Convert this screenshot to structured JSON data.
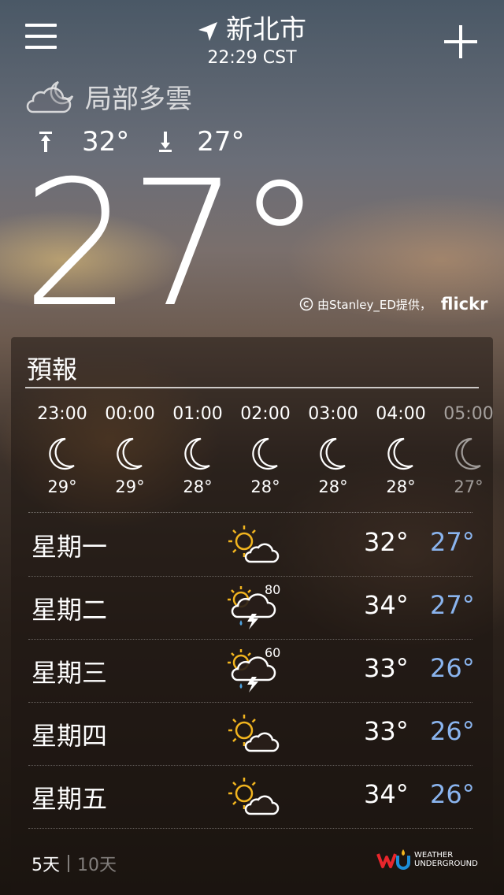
{
  "header": {
    "city": "新北市",
    "time": "22:29 CST",
    "menu_icon": "hamburger-menu-icon",
    "add_icon": "plus-icon",
    "location_icon": "location-arrow-icon"
  },
  "current": {
    "condition": "局部多雲",
    "condition_icon": "partly-cloudy-night-icon",
    "high": "32°",
    "low": "27°",
    "temperature": "27°"
  },
  "photo_credit": {
    "text": "由Stanley_ED提供，",
    "brand": "flickr"
  },
  "forecast": {
    "title": "預報",
    "hourly": [
      {
        "time": "23:00",
        "temp": "29°",
        "icon": "moon-icon"
      },
      {
        "time": "00:00",
        "temp": "29°",
        "icon": "moon-icon"
      },
      {
        "time": "01:00",
        "temp": "28°",
        "icon": "moon-icon"
      },
      {
        "time": "02:00",
        "temp": "28°",
        "icon": "moon-icon"
      },
      {
        "time": "03:00",
        "temp": "28°",
        "icon": "moon-icon"
      },
      {
        "time": "04:00",
        "temp": "28°",
        "icon": "moon-icon"
      },
      {
        "time": "05:00",
        "temp": "27°",
        "icon": "moon-icon"
      }
    ],
    "daily": [
      {
        "day": "星期一",
        "icon": "sun-cloud-icon",
        "pop": "",
        "high": "32°",
        "low": "27°"
      },
      {
        "day": "星期二",
        "icon": "sun-storm-icon",
        "pop": "80",
        "high": "34°",
        "low": "27°"
      },
      {
        "day": "星期三",
        "icon": "sun-storm-icon",
        "pop": "60",
        "high": "33°",
        "low": "26°"
      },
      {
        "day": "星期四",
        "icon": "sun-cloud-icon",
        "pop": "",
        "high": "33°",
        "low": "26°"
      },
      {
        "day": "星期五",
        "icon": "sun-cloud-icon",
        "pop": "",
        "high": "34°",
        "low": "26°"
      }
    ],
    "tabs": {
      "five_day": "5天",
      "ten_day": "10天"
    },
    "provider_line1": "WEATHER",
    "provider_line2": "UNDERGROUND"
  },
  "colors": {
    "low_temp": "#8ab4ee",
    "sun": "#f2b51f",
    "rain": "#4fa3e0"
  }
}
